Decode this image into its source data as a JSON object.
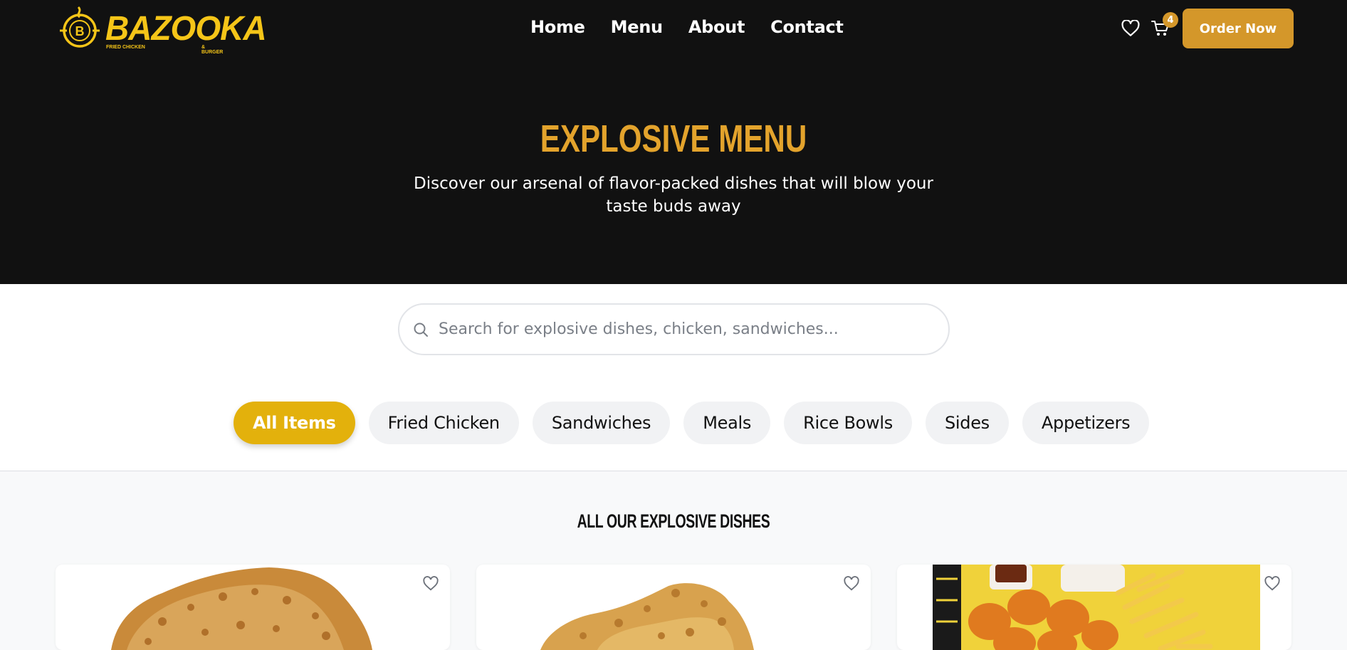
{
  "brand": {
    "name": "BAZOOKA",
    "tagline_left": "FRIED CHICKEN",
    "tagline_right": "& BURGER",
    "logo_mark": "B"
  },
  "nav": {
    "items": [
      "Home",
      "Menu",
      "About",
      "Contact"
    ]
  },
  "header_actions": {
    "wishlist_icon": "heart-icon",
    "cart_icon": "cart-icon",
    "cart_count": "4",
    "order_button": "Order Now"
  },
  "hero": {
    "title": "EXPLOSIVE MENU",
    "subtitle": "Discover our arsenal of flavor-packed dishes that will blow your taste buds away"
  },
  "search": {
    "placeholder": "Search for explosive dishes, chicken, sandwiches...",
    "value": ""
  },
  "categories": {
    "items": [
      "All Items",
      "Fried Chicken",
      "Sandwiches",
      "Meals",
      "Rice Bowls",
      "Sides",
      "Appetizers"
    ],
    "selected": "All Items"
  },
  "products": {
    "section_title": "ALL OUR EXPLOSIVE DISHES",
    "cards": [
      {
        "image": "fried-chicken-pile",
        "fav_icon": "heart-icon"
      },
      {
        "image": "chicken-strips",
        "fav_icon": "heart-icon"
      },
      {
        "image": "nuggets-and-fries-box",
        "fav_icon": "heart-icon"
      }
    ]
  },
  "colors": {
    "header_bg": "#111111",
    "accent": "#d4972a",
    "hero_title": "#e3a32c",
    "chip_active": "#e3b10c",
    "chip_bg": "#f1f2f4"
  }
}
